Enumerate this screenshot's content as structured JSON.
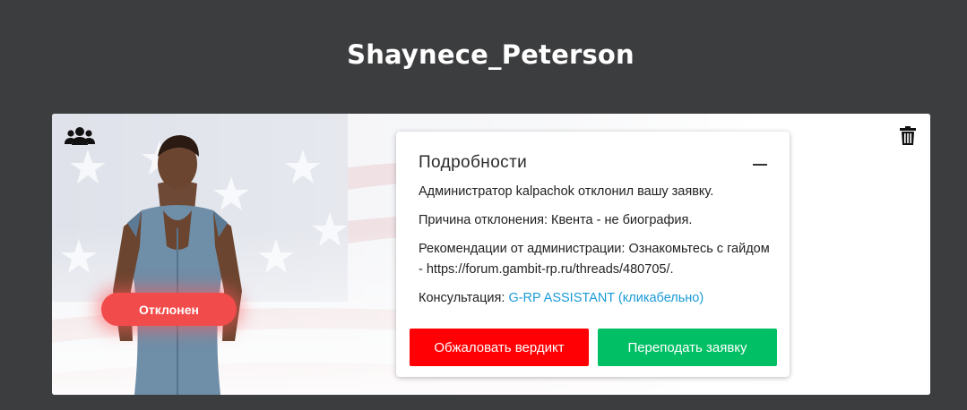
{
  "page": {
    "title": "Shaynece_Peterson"
  },
  "card": {
    "status_badge": "Отклонен",
    "group_icon": "users-group-icon",
    "trash_icon": "trash-icon",
    "details": {
      "title": "Подробности",
      "collapse_icon": "minus-icon",
      "admin_line": "Администратор kalpachok отклонил вашу заявку.",
      "reason_line": "Причина отклонения: Квента - не биография.",
      "recommendation_line": "Рекомендации от администрации: Ознакомьтесь с гайдом - https://forum.gambit-rp.ru/threads/480705/.",
      "consultation_label": "Консультация: ",
      "consultation_link": "G-RP ASSISTANT (кликабельно)",
      "appeal_button": "Обжаловать вердикт",
      "resubmit_button": "Переподать заявку"
    }
  },
  "colors": {
    "page_background": "#3c3d3f",
    "status_rejected": "#f24b4b",
    "appeal_button": "#ff0004",
    "resubmit_button": "#00bf64",
    "link": "#1a9bd7"
  }
}
